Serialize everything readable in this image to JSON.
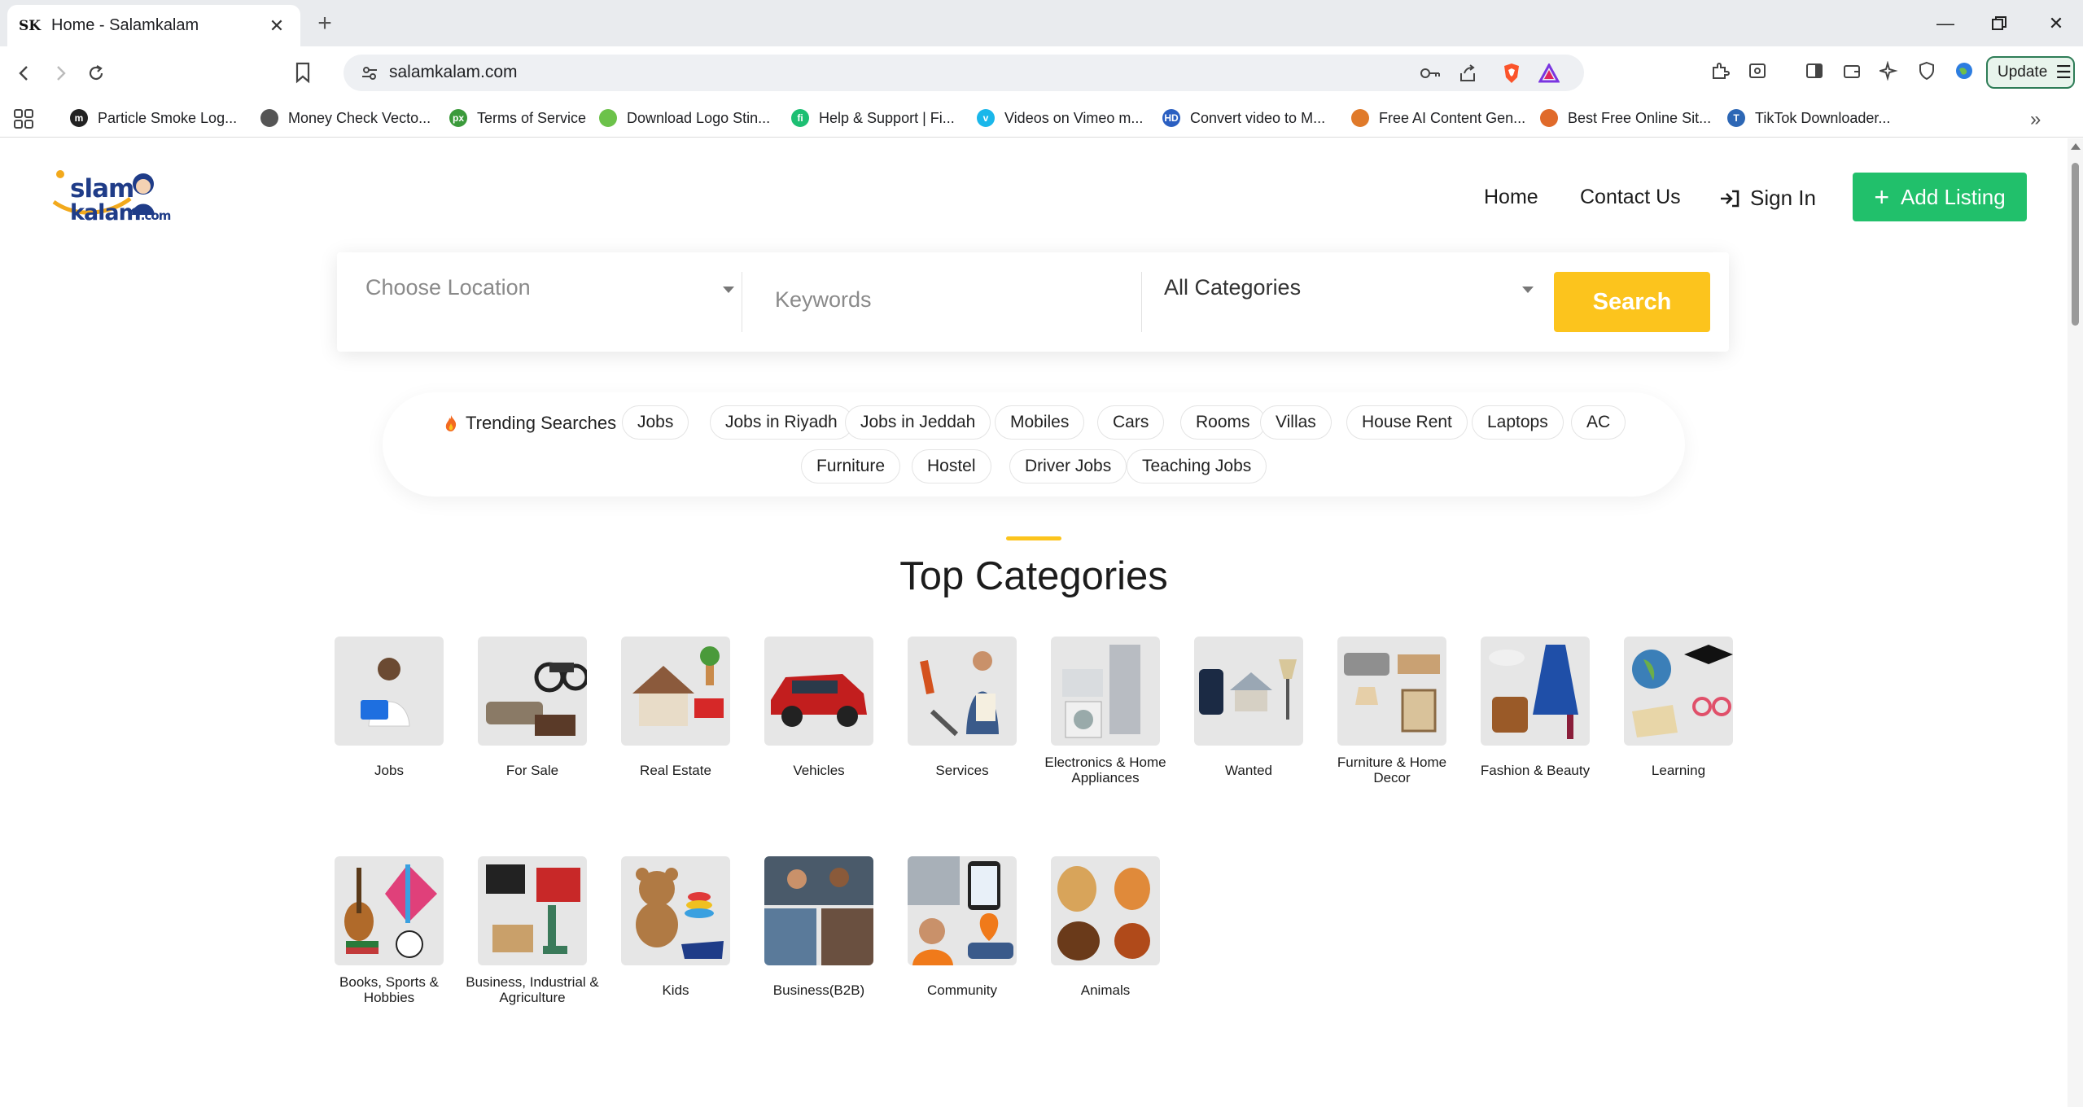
{
  "browser": {
    "tab_title": "Home - Salamkalam",
    "tab_favicon": "SK",
    "url": "salamkalam.com",
    "update_label": "Update",
    "bookmarks": [
      {
        "label": "Particle Smoke Log...",
        "icon": "m",
        "color": "#222222"
      },
      {
        "label": "Money Check Vecto...",
        "icon": "globe",
        "color": "#555555"
      },
      {
        "label": "Terms of Service",
        "icon": "px",
        "color": "#3b9a3b"
      },
      {
        "label": "Download Logo Stin...",
        "icon": "leaf",
        "color": "#6cc24a"
      },
      {
        "label": "Help & Support | Fi...",
        "icon": "fi",
        "color": "#1dbf73"
      },
      {
        "label": "Videos on Vimeo m...",
        "icon": "v",
        "color": "#1ab7ea"
      },
      {
        "label": "Convert video to M...",
        "icon": "HD",
        "color": "#2b5fc1"
      },
      {
        "label": "Free AI Content Gen...",
        "icon": "fox",
        "color": "#e07a2a"
      },
      {
        "label": "Best Free Online Sit...",
        "icon": "swirl",
        "color": "#e06a2a"
      },
      {
        "label": "TikTok Downloader...",
        "icon": "T",
        "color": "#2d67b5"
      }
    ]
  },
  "site": {
    "logo_line1": "slam",
    "logo_line2": "kalam",
    "logo_suffix": ".com",
    "nav": {
      "home": "Home",
      "contact": "Contact Us",
      "signin": "Sign In",
      "add_listing": "Add Listing"
    },
    "search": {
      "location_placeholder": "Choose Location",
      "keywords_placeholder": "Keywords",
      "category_value": "All Categories",
      "button": "Search"
    },
    "trending": {
      "label": "Trending Searches",
      "chips": [
        "Jobs",
        "Jobs in Riyadh",
        "Jobs in Jeddah",
        "Mobiles",
        "Cars",
        "Rooms",
        "Villas",
        "House Rent",
        "Laptops",
        "AC",
        "Furniture",
        "Hostel",
        "Driver Jobs",
        "Teaching Jobs"
      ]
    },
    "categories_title": "Top Categories",
    "categories": [
      {
        "name": "Jobs",
        "icon": "person-laptop-icon"
      },
      {
        "name": "For Sale",
        "icon": "motorbike-sofa-icon"
      },
      {
        "name": "Real Estate",
        "icon": "house-for-rent-icon"
      },
      {
        "name": "Vehicles",
        "icon": "red-car-icon"
      },
      {
        "name": "Services",
        "icon": "plumber-tools-icon"
      },
      {
        "name": "Electronics & Home Appliances",
        "icon": "appliances-icon"
      },
      {
        "name": "Wanted",
        "icon": "phone-house-lamp-icon"
      },
      {
        "name": "Furniture & Home Decor",
        "icon": "sofa-bed-lamp-icon"
      },
      {
        "name": "Fashion & Beauty",
        "icon": "dress-bag-shoes-icon"
      },
      {
        "name": "Learning",
        "icon": "globe-book-cap-icon"
      },
      {
        "name": "Books, Sports & Hobbies",
        "icon": "guitar-kite-ball-icon"
      },
      {
        "name": "Business, Industrial & Agriculture",
        "icon": "generator-machinery-icon"
      },
      {
        "name": "Kids",
        "icon": "teddy-toys-icon"
      },
      {
        "name": "Business(B2B)",
        "icon": "business-people-icon"
      },
      {
        "name": "Community",
        "icon": "community-phone-icon"
      },
      {
        "name": "Animals",
        "icon": "dog-cat-horse-icon"
      }
    ]
  }
}
